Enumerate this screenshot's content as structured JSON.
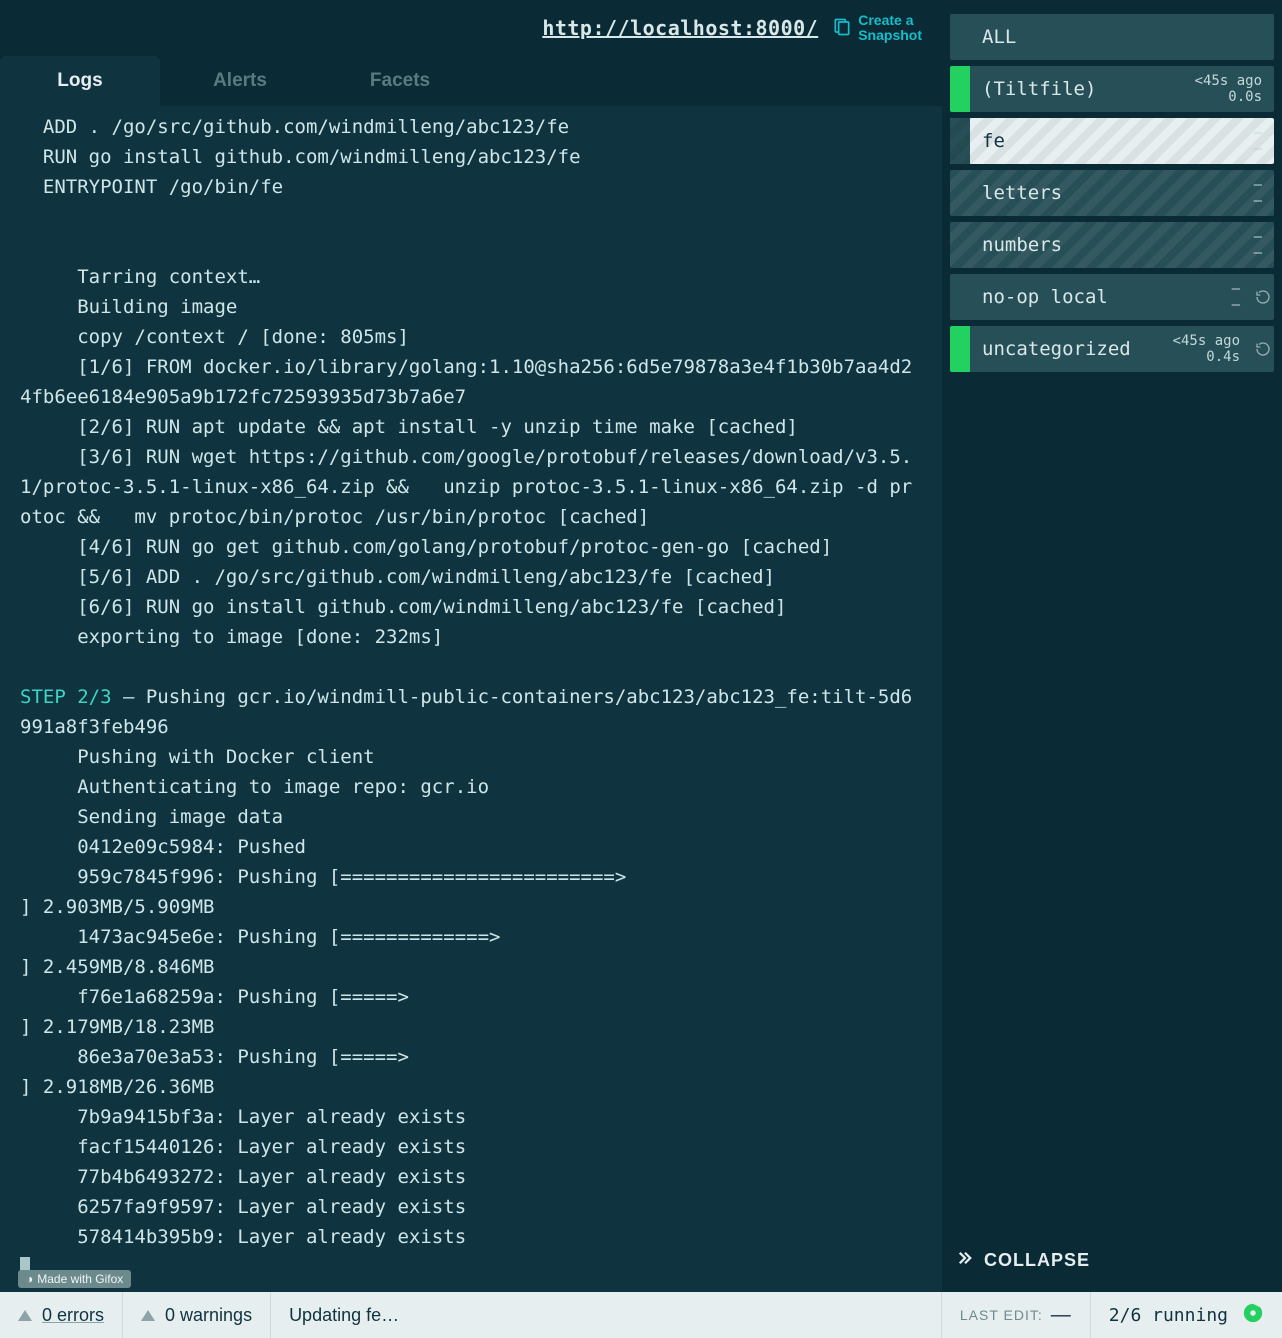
{
  "header": {
    "url": "http://localhost:8000/",
    "snapshot_line1": "Create a",
    "snapshot_line2": "Snapshot"
  },
  "tabs": [
    {
      "label": "Logs",
      "active": true
    },
    {
      "label": "Alerts",
      "active": false
    },
    {
      "label": "Facets",
      "active": false
    }
  ],
  "logs": [
    {
      "text": "  ADD . /go/src/github.com/windmilleng/abc123/fe"
    },
    {
      "text": "  RUN go install github.com/windmilleng/abc123/fe"
    },
    {
      "text": "  ENTRYPOINT /go/bin/fe"
    },
    {
      "text": ""
    },
    {
      "text": ""
    },
    {
      "text": "     Tarring context…"
    },
    {
      "text": "     Building image"
    },
    {
      "text": "     copy /context / [done: 805ms]"
    },
    {
      "text": "     [1/6] FROM docker.io/library/golang:1.10@sha256:6d5e79878a3e4f1b30b7aa4d24fb6ee6184e905a9b172fc72593935d73b7a6e7"
    },
    {
      "text": "     [2/6] RUN apt update && apt install -y unzip time make [cached]"
    },
    {
      "text": "     [3/6] RUN wget https://github.com/google/protobuf/releases/download/v3.5.1/protoc-3.5.1-linux-x86_64.zip &&   unzip protoc-3.5.1-linux-x86_64.zip -d protoc &&   mv protoc/bin/protoc /usr/bin/protoc [cached]"
    },
    {
      "text": "     [4/6] RUN go get github.com/golang/protobuf/protoc-gen-go [cached]"
    },
    {
      "text": "     [5/6] ADD . /go/src/github.com/windmilleng/abc123/fe [cached]"
    },
    {
      "text": "     [6/6] RUN go install github.com/windmilleng/abc123/fe [cached]"
    },
    {
      "text": "     exporting to image [done: 232ms]"
    },
    {
      "text": ""
    },
    {
      "step": "STEP 2/3",
      "text": " — Pushing gcr.io/windmill-public-containers/abc123/abc123_fe:tilt-5d6991a8f3feb496"
    },
    {
      "text": "     Pushing with Docker client"
    },
    {
      "text": "     Authenticating to image repo: gcr.io"
    },
    {
      "text": "     Sending image data"
    },
    {
      "text": "     0412e09c5984: Pushed"
    },
    {
      "text": "     959c7845f996: Pushing [========================>                           ] 2.903MB/5.909MB"
    },
    {
      "text": "     1473ac945e6e: Pushing [=============>                                       ] 2.459MB/8.846MB"
    },
    {
      "text": "     f76e1a68259a: Pushing [=====>                                               ] 2.179MB/18.23MB"
    },
    {
      "text": "     86e3a70e3a53: Pushing [=====>                                               ] 2.918MB/26.36MB"
    },
    {
      "text": "     7b9a9415bf3a: Layer already exists"
    },
    {
      "text": "     facf15440126: Layer already exists"
    },
    {
      "text": "     77b4b6493272: Layer already exists"
    },
    {
      "text": "     6257fa9f9597: Layer already exists"
    },
    {
      "text": "     578414b395b9: Layer already exists"
    }
  ],
  "resources": [
    {
      "name": "ALL",
      "bar": "dim",
      "ago": "",
      "dur": "",
      "refresh": false,
      "hatch": false,
      "selected": false
    },
    {
      "name": "(Tiltfile)",
      "bar": "green",
      "ago": "<45s ago",
      "dur": "0.0s",
      "refresh": false,
      "hatch": false,
      "selected": false
    },
    {
      "name": "fe",
      "bar": "dim",
      "ago": "—",
      "dur": "—",
      "refresh": false,
      "hatch": true,
      "selected": true
    },
    {
      "name": "letters",
      "bar": "dim",
      "ago": "—",
      "dur": "—",
      "refresh": false,
      "hatch": true,
      "selected": false
    },
    {
      "name": "numbers",
      "bar": "dim",
      "ago": "—",
      "dur": "—",
      "refresh": false,
      "hatch": true,
      "selected": false
    },
    {
      "name": "no-op local",
      "bar": "dim",
      "ago": "—",
      "dur": "—",
      "refresh": true,
      "hatch": false,
      "selected": false
    },
    {
      "name": "uncategorized",
      "bar": "green",
      "ago": "<45s ago",
      "dur": "0.4s",
      "refresh": true,
      "hatch": false,
      "selected": false
    }
  ],
  "collapse_label": "COLLAPSE",
  "status": {
    "errors": "0 errors",
    "warnings": "0 warnings",
    "updating": "Updating fe…",
    "last_edit_label": "LAST EDIT:",
    "last_edit_value": "—",
    "running": "2/6 running"
  },
  "gifox": "Made with Gifox"
}
